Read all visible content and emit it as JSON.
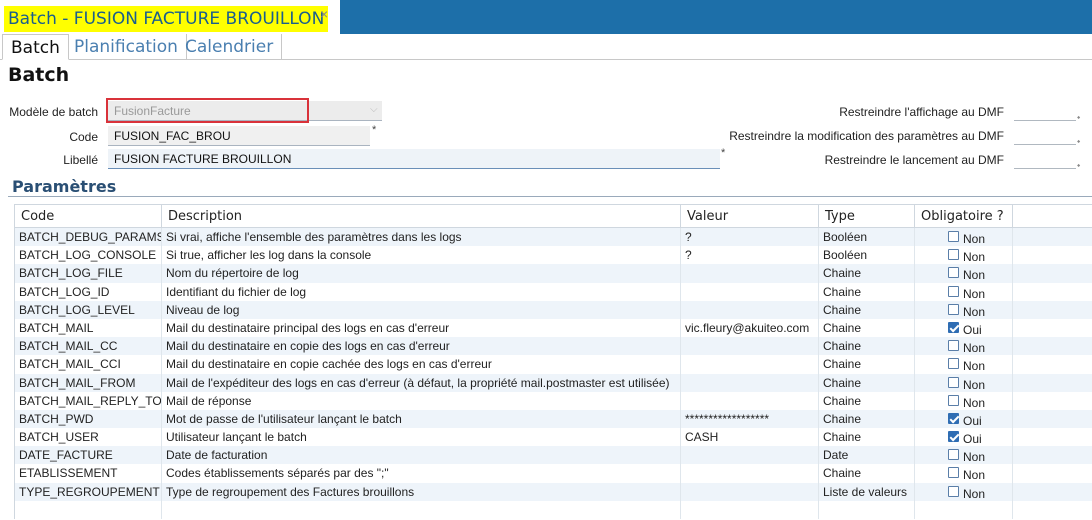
{
  "window": {
    "doc_tab_title": "Batch - FUSION FACTURE BROUILLON",
    "close_glyph": "×"
  },
  "subtabs": [
    "Batch",
    "Planification",
    "Calendrier"
  ],
  "page_title": "Batch",
  "form": {
    "model_label": "Modèle de batch",
    "model_value": "FusionFacture",
    "code_label": "Code",
    "code_value": "FUSION_FAC_BROU",
    "libelle_label": "Libellé",
    "libelle_value": "FUSION FACTURE BROUILLON",
    "required_mark": "*",
    "restrict_display_label": "Restreindre l'affichage au DMF",
    "restrict_modify_label": "Restreindre la modification des paramètres au DMF",
    "restrict_launch_label": "Restreindre le lancement au DMF"
  },
  "params": {
    "title": "Paramètres",
    "columns": [
      "Code",
      "Description",
      "Valeur",
      "Type",
      "Obligatoire ?"
    ],
    "rows": [
      {
        "code": "BATCH_DEBUG_PARAMS",
        "desc": "Si vrai, affiche l'ensemble des paramètres dans les logs",
        "value": "?",
        "type": "Booléen",
        "required": false,
        "req_label": "Non"
      },
      {
        "code": "BATCH_LOG_CONSOLE",
        "desc": "Si true, afficher les log dans la console",
        "value": "?",
        "type": "Booléen",
        "required": false,
        "req_label": "Non"
      },
      {
        "code": "BATCH_LOG_FILE",
        "desc": "Nom du répertoire de log",
        "value": "",
        "type": "Chaine",
        "required": false,
        "req_label": "Non"
      },
      {
        "code": "BATCH_LOG_ID",
        "desc": "Identifiant du fichier de log",
        "value": "",
        "type": "Chaine",
        "required": false,
        "req_label": "Non"
      },
      {
        "code": "BATCH_LOG_LEVEL",
        "desc": "Niveau de log",
        "value": "",
        "type": "Chaine",
        "required": false,
        "req_label": "Non"
      },
      {
        "code": "BATCH_MAIL",
        "desc": "Mail du destinataire principal des logs en cas d'erreur",
        "value": "vic.fleury@akuiteo.com",
        "type": "Chaine",
        "required": true,
        "req_label": "Oui"
      },
      {
        "code": "BATCH_MAIL_CC",
        "desc": "Mail du destinataire en copie des logs en cas d'erreur",
        "value": "",
        "type": "Chaine",
        "required": false,
        "req_label": "Non"
      },
      {
        "code": "BATCH_MAIL_CCI",
        "desc": "Mail du destinataire en copie cachée des logs en cas d'erreur",
        "value": "",
        "type": "Chaine",
        "required": false,
        "req_label": "Non"
      },
      {
        "code": "BATCH_MAIL_FROM",
        "desc": "Mail de l'expéditeur des logs en cas d'erreur (à défaut, la propriété mail.postmaster est utilisée)",
        "value": "",
        "type": "Chaine",
        "required": false,
        "req_label": "Non"
      },
      {
        "code": "BATCH_MAIL_REPLY_TO",
        "desc": "Mail de réponse",
        "value": "",
        "type": "Chaine",
        "required": false,
        "req_label": "Non"
      },
      {
        "code": "BATCH_PWD",
        "desc": "Mot de passe de l'utilisateur lançant le batch",
        "value": "******************",
        "type": "Chaine",
        "required": true,
        "req_label": "Oui"
      },
      {
        "code": "BATCH_USER",
        "desc": "Utilisateur lançant le batch",
        "value": "CASH",
        "type": "Chaine",
        "required": true,
        "req_label": "Oui"
      },
      {
        "code": "DATE_FACTURE",
        "desc": "Date de facturation",
        "value": "",
        "type": "Date",
        "required": false,
        "req_label": "Non"
      },
      {
        "code": "ETABLISSEMENT",
        "desc": "Codes établissements séparés par des \";\"",
        "value": "",
        "type": "Chaine",
        "required": false,
        "req_label": "Non"
      },
      {
        "code": "TYPE_REGROUPEMENT",
        "desc": "Type de regroupement des Factures brouillons",
        "value": "",
        "type": "Liste de valeurs",
        "required": false,
        "req_label": "Non"
      }
    ]
  }
}
